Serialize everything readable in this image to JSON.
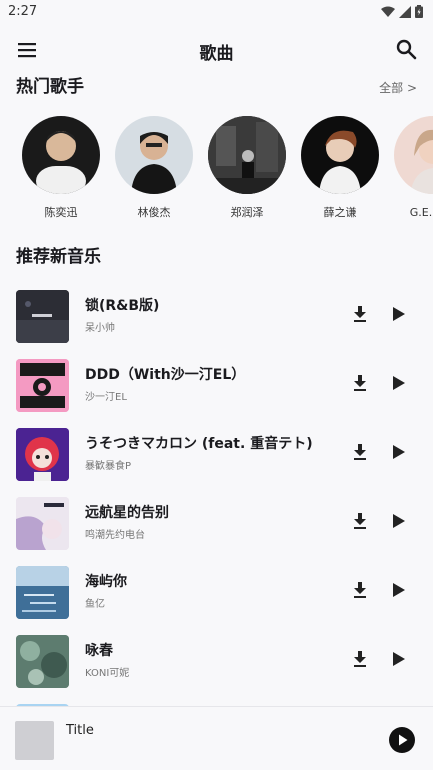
{
  "status": {
    "time": "2:27"
  },
  "appbar": {
    "title": "歌曲"
  },
  "hot_singers": {
    "title": "热门歌手",
    "more": "全部 >",
    "items": [
      {
        "name": "陈奕迅"
      },
      {
        "name": "林俊杰"
      },
      {
        "name": "郑润泽"
      },
      {
        "name": "薛之谦"
      },
      {
        "name": "G.E.M.邓"
      }
    ]
  },
  "new_music": {
    "title": "推荐新音乐",
    "songs": [
      {
        "title": "锁(R&B版)",
        "artist": "呆小帅"
      },
      {
        "title": "DDD（With沙一汀EL）",
        "artist": "沙一汀EL"
      },
      {
        "title": "うそつきマカロン (feat. 重音テト)",
        "artist": "暴歓暴食P"
      },
      {
        "title": "远航星的告别",
        "artist": "鸣潮先约电台"
      },
      {
        "title": "海屿你",
        "artist": "鱼亿"
      },
      {
        "title": "咏春",
        "artist": "KONI可妮"
      }
    ]
  },
  "mini_player": {
    "title": "Title"
  },
  "colors": {
    "background": "#f8f8fa",
    "text": "#1b1b1f",
    "secondary": "#777777"
  }
}
